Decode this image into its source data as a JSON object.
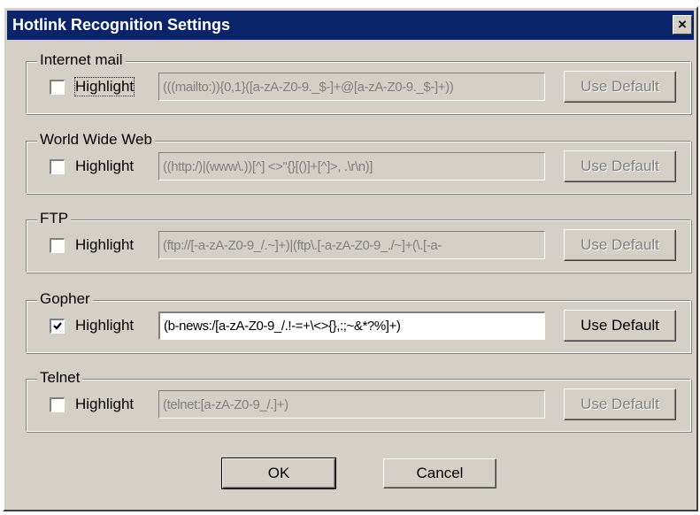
{
  "window": {
    "title": "Hotlink Recognition Settings",
    "close_glyph": "×",
    "titlebar_color": "#0a246a",
    "face_color": "#d4d0c8"
  },
  "groups": [
    {
      "label": "Internet mail",
      "highlight_label": "Highlight",
      "checked": false,
      "pattern": "(((mailto:)){0,1}([a-zA-Z0-9._$-]+@[a-zA-Z0-9._$-]+))",
      "enabled": false,
      "default_label": "Use Default"
    },
    {
      "label": "World Wide Web",
      "highlight_label": "Highlight",
      "checked": false,
      "pattern": "((http:/)|(www\\.))[^] <>\"{}[()]+[^]>, .\\r\\n)]",
      "enabled": false,
      "default_label": "Use Default"
    },
    {
      "label": "FTP",
      "highlight_label": "Highlight",
      "checked": false,
      "pattern": "(ftp://[-a-zA-Z0-9_/.~]+)|(ftp\\.[-a-zA-Z0-9_./~]+(\\.[-a-",
      "enabled": false,
      "default_label": "Use Default"
    },
    {
      "label": "Gopher",
      "highlight_label": "Highlight",
      "checked": true,
      "pattern": "(b-news:/[a-zA-Z0-9_/.!-=+\\<>{},:;~&*?%]+)",
      "enabled": true,
      "default_label": "Use Default"
    },
    {
      "label": "Telnet",
      "highlight_label": "Highlight",
      "checked": false,
      "pattern": "(telnet:[a-zA-Z0-9_/.]+)",
      "enabled": false,
      "default_label": "Use Default"
    }
  ],
  "buttons": {
    "ok_label": "OK",
    "cancel_label": "Cancel"
  }
}
